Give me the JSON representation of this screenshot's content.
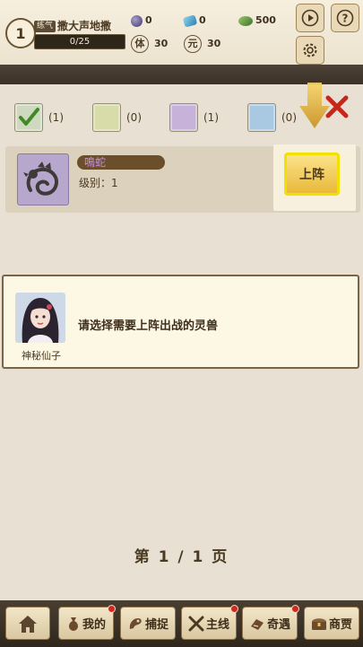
{
  "header": {
    "level": "1",
    "realm": "练气",
    "player_name": "撒大声地撒",
    "exp": "0/25",
    "resources": {
      "purple_gem": "0",
      "blue_gem": "0",
      "green_gem": "500",
      "stat1_glyph": "体",
      "stat1_value": "30",
      "stat2_glyph": "元",
      "stat2_value": "30"
    }
  },
  "filters": [
    {
      "color": "#7aa35a",
      "count": "(1)",
      "checked": true
    },
    {
      "color": "#d8dca9",
      "count": "(0)"
    },
    {
      "color": "#c7b3d9",
      "count": "(1)"
    },
    {
      "color": "#a9c9e2",
      "count": "(0)"
    }
  ],
  "beast": {
    "name": "鳴蛇",
    "level_label": "级别：",
    "level_value": "1",
    "deploy_label": "上阵"
  },
  "dialog": {
    "npc_name": "神秘仙子",
    "text": "请选择需要上阵出战的灵兽"
  },
  "pager": {
    "prefix": "第",
    "current": "1",
    "sep": "/",
    "total": "1",
    "suffix": "页"
  },
  "nav": {
    "home_icon": "home-icon",
    "mine": "我的",
    "capture": "捕捉",
    "mainline": "主线",
    "encounter": "奇遇",
    "shop": "商贾"
  }
}
